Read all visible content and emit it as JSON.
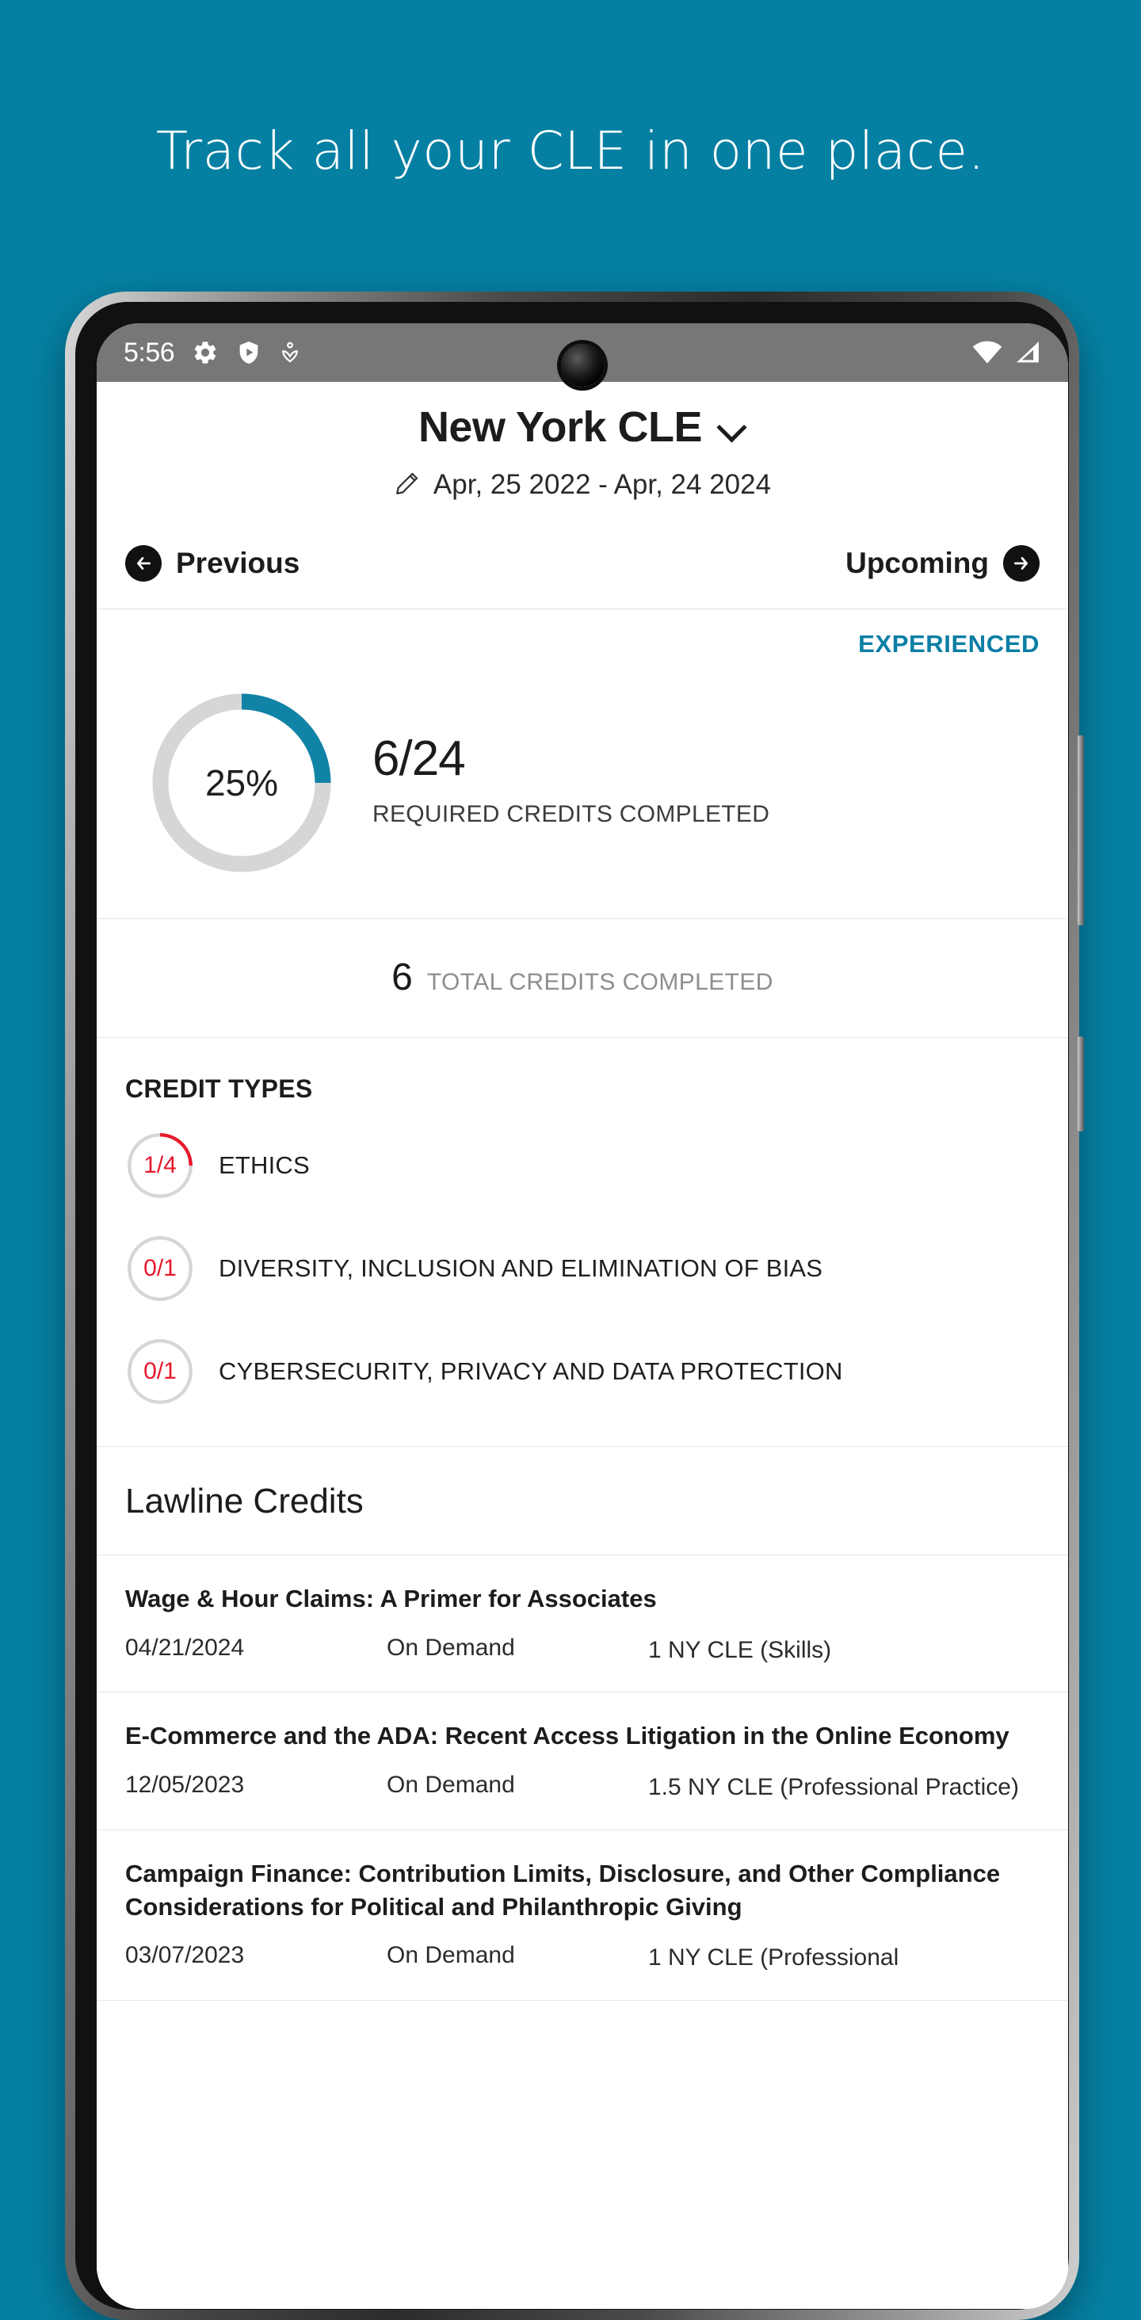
{
  "hero": {
    "headline": "Track all your CLE in one place."
  },
  "colors": {
    "background_teal": "#0580a3",
    "accent_teal": "#0a7ea4",
    "progress_teal": "#1183a6",
    "ring_red": "#e8192c",
    "track_gray": "#d6d6d6"
  },
  "status_bar": {
    "time": "5:56",
    "left_icons": [
      "gear-icon",
      "shield-play-icon",
      "person-heart-icon"
    ],
    "right_icons": [
      "wifi-icon",
      "cellular-signal-icon"
    ]
  },
  "header": {
    "title": "New York CLE",
    "dropdown_icon": "chevron-down-icon",
    "edit_icon": "pencil-icon",
    "date_range": "Apr, 25 2022 - Apr, 24 2024"
  },
  "nav": {
    "previous_label": "Previous",
    "previous_icon": "arrow-left-circle-icon",
    "upcoming_label": "Upcoming",
    "upcoming_icon": "arrow-right-circle-icon"
  },
  "progress": {
    "badge": "EXPERIENCED",
    "percent_label": "25%",
    "percent_value": 25,
    "fraction": "6/24",
    "fraction_caption": "REQUIRED CREDITS COMPLETED",
    "total_number": "6",
    "total_caption": "TOTAL CREDITS COMPLETED"
  },
  "credit_types": {
    "heading": "CREDIT TYPES",
    "items": [
      {
        "fraction": "1/4",
        "percent": 25,
        "label": "ETHICS"
      },
      {
        "fraction": "0/1",
        "percent": 0,
        "label": "DIVERSITY, INCLUSION AND ELIMINATION OF BIAS"
      },
      {
        "fraction": "0/1",
        "percent": 0,
        "label": "CYBERSECURITY, PRIVACY AND DATA PROTECTION"
      }
    ]
  },
  "lawline": {
    "section_title": "Lawline Credits",
    "items": [
      {
        "title": "Wage & Hour Claims: A Primer for Associates",
        "date": "04/21/2024",
        "format": "On Demand",
        "credits": "1 NY CLE (Skills)"
      },
      {
        "title": "E-Commerce and the ADA: Recent Access Litigation in the Online Economy",
        "date": "12/05/2023",
        "format": "On Demand",
        "credits": "1.5 NY CLE (Professional Practice)"
      },
      {
        "title": "Campaign Finance: Contribution Limits, Disclosure, and Other Compliance Considerations for Political and Philanthropic Giving",
        "date": "03/07/2023",
        "format": "On Demand",
        "credits": "1 NY CLE (Professional"
      }
    ]
  },
  "chart_data": [
    {
      "type": "pie",
      "title": "Required credits completed",
      "categories": [
        "Completed",
        "Remaining"
      ],
      "values": [
        6,
        18
      ],
      "percent_complete": 25,
      "center_label": "25%",
      "colors": [
        "#1183a6",
        "#d6d6d6"
      ]
    },
    {
      "type": "pie",
      "title": "ETHICS",
      "categories": [
        "Completed",
        "Remaining"
      ],
      "values": [
        1,
        3
      ],
      "percent_complete": 25,
      "center_label": "1/4",
      "colors": [
        "#e8192c",
        "#d6d6d6"
      ]
    },
    {
      "type": "pie",
      "title": "DIVERSITY, INCLUSION AND ELIMINATION OF BIAS",
      "categories": [
        "Completed",
        "Remaining"
      ],
      "values": [
        0,
        1
      ],
      "percent_complete": 0,
      "center_label": "0/1",
      "colors": [
        "#e8192c",
        "#d6d6d6"
      ]
    },
    {
      "type": "pie",
      "title": "CYBERSECURITY, PRIVACY AND DATA PROTECTION",
      "categories": [
        "Completed",
        "Remaining"
      ],
      "values": [
        0,
        1
      ],
      "percent_complete": 0,
      "center_label": "0/1",
      "colors": [
        "#e8192c",
        "#d6d6d6"
      ]
    }
  ]
}
